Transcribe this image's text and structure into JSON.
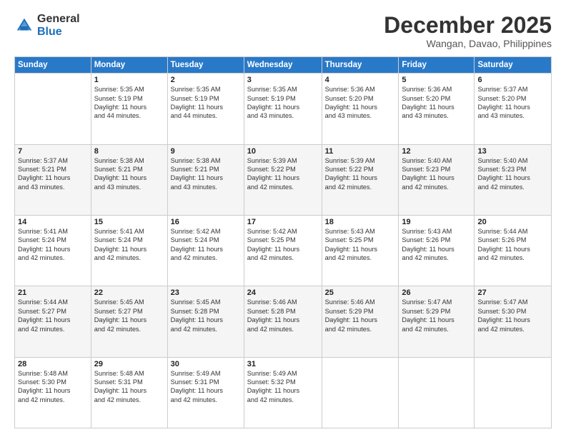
{
  "header": {
    "logo_general": "General",
    "logo_blue": "Blue",
    "month_title": "December 2025",
    "location": "Wangan, Davao, Philippines"
  },
  "days_of_week": [
    "Sunday",
    "Monday",
    "Tuesday",
    "Wednesday",
    "Thursday",
    "Friday",
    "Saturday"
  ],
  "weeks": [
    [
      {
        "day": "",
        "info": ""
      },
      {
        "day": "1",
        "info": "Sunrise: 5:35 AM\nSunset: 5:19 PM\nDaylight: 11 hours\nand 44 minutes."
      },
      {
        "day": "2",
        "info": "Sunrise: 5:35 AM\nSunset: 5:19 PM\nDaylight: 11 hours\nand 44 minutes."
      },
      {
        "day": "3",
        "info": "Sunrise: 5:35 AM\nSunset: 5:19 PM\nDaylight: 11 hours\nand 43 minutes."
      },
      {
        "day": "4",
        "info": "Sunrise: 5:36 AM\nSunset: 5:20 PM\nDaylight: 11 hours\nand 43 minutes."
      },
      {
        "day": "5",
        "info": "Sunrise: 5:36 AM\nSunset: 5:20 PM\nDaylight: 11 hours\nand 43 minutes."
      },
      {
        "day": "6",
        "info": "Sunrise: 5:37 AM\nSunset: 5:20 PM\nDaylight: 11 hours\nand 43 minutes."
      }
    ],
    [
      {
        "day": "7",
        "info": "Sunrise: 5:37 AM\nSunset: 5:21 PM\nDaylight: 11 hours\nand 43 minutes."
      },
      {
        "day": "8",
        "info": "Sunrise: 5:38 AM\nSunset: 5:21 PM\nDaylight: 11 hours\nand 43 minutes."
      },
      {
        "day": "9",
        "info": "Sunrise: 5:38 AM\nSunset: 5:21 PM\nDaylight: 11 hours\nand 43 minutes."
      },
      {
        "day": "10",
        "info": "Sunrise: 5:39 AM\nSunset: 5:22 PM\nDaylight: 11 hours\nand 42 minutes."
      },
      {
        "day": "11",
        "info": "Sunrise: 5:39 AM\nSunset: 5:22 PM\nDaylight: 11 hours\nand 42 minutes."
      },
      {
        "day": "12",
        "info": "Sunrise: 5:40 AM\nSunset: 5:23 PM\nDaylight: 11 hours\nand 42 minutes."
      },
      {
        "day": "13",
        "info": "Sunrise: 5:40 AM\nSunset: 5:23 PM\nDaylight: 11 hours\nand 42 minutes."
      }
    ],
    [
      {
        "day": "14",
        "info": "Sunrise: 5:41 AM\nSunset: 5:24 PM\nDaylight: 11 hours\nand 42 minutes."
      },
      {
        "day": "15",
        "info": "Sunrise: 5:41 AM\nSunset: 5:24 PM\nDaylight: 11 hours\nand 42 minutes."
      },
      {
        "day": "16",
        "info": "Sunrise: 5:42 AM\nSunset: 5:24 PM\nDaylight: 11 hours\nand 42 minutes."
      },
      {
        "day": "17",
        "info": "Sunrise: 5:42 AM\nSunset: 5:25 PM\nDaylight: 11 hours\nand 42 minutes."
      },
      {
        "day": "18",
        "info": "Sunrise: 5:43 AM\nSunset: 5:25 PM\nDaylight: 11 hours\nand 42 minutes."
      },
      {
        "day": "19",
        "info": "Sunrise: 5:43 AM\nSunset: 5:26 PM\nDaylight: 11 hours\nand 42 minutes."
      },
      {
        "day": "20",
        "info": "Sunrise: 5:44 AM\nSunset: 5:26 PM\nDaylight: 11 hours\nand 42 minutes."
      }
    ],
    [
      {
        "day": "21",
        "info": "Sunrise: 5:44 AM\nSunset: 5:27 PM\nDaylight: 11 hours\nand 42 minutes."
      },
      {
        "day": "22",
        "info": "Sunrise: 5:45 AM\nSunset: 5:27 PM\nDaylight: 11 hours\nand 42 minutes."
      },
      {
        "day": "23",
        "info": "Sunrise: 5:45 AM\nSunset: 5:28 PM\nDaylight: 11 hours\nand 42 minutes."
      },
      {
        "day": "24",
        "info": "Sunrise: 5:46 AM\nSunset: 5:28 PM\nDaylight: 11 hours\nand 42 minutes."
      },
      {
        "day": "25",
        "info": "Sunrise: 5:46 AM\nSunset: 5:29 PM\nDaylight: 11 hours\nand 42 minutes."
      },
      {
        "day": "26",
        "info": "Sunrise: 5:47 AM\nSunset: 5:29 PM\nDaylight: 11 hours\nand 42 minutes."
      },
      {
        "day": "27",
        "info": "Sunrise: 5:47 AM\nSunset: 5:30 PM\nDaylight: 11 hours\nand 42 minutes."
      }
    ],
    [
      {
        "day": "28",
        "info": "Sunrise: 5:48 AM\nSunset: 5:30 PM\nDaylight: 11 hours\nand 42 minutes."
      },
      {
        "day": "29",
        "info": "Sunrise: 5:48 AM\nSunset: 5:31 PM\nDaylight: 11 hours\nand 42 minutes."
      },
      {
        "day": "30",
        "info": "Sunrise: 5:49 AM\nSunset: 5:31 PM\nDaylight: 11 hours\nand 42 minutes."
      },
      {
        "day": "31",
        "info": "Sunrise: 5:49 AM\nSunset: 5:32 PM\nDaylight: 11 hours\nand 42 minutes."
      },
      {
        "day": "",
        "info": ""
      },
      {
        "day": "",
        "info": ""
      },
      {
        "day": "",
        "info": ""
      }
    ]
  ]
}
